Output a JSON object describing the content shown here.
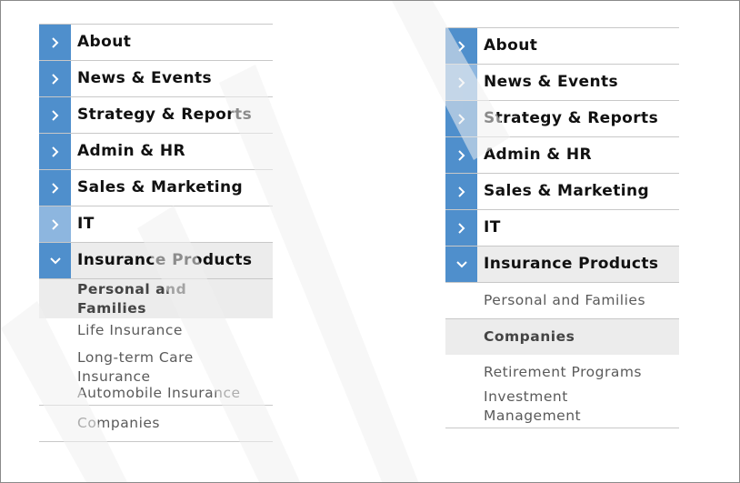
{
  "left_menu": {
    "items": [
      {
        "label": "About"
      },
      {
        "label": "News & Events"
      },
      {
        "label": "Strategy & Reports"
      },
      {
        "label": "Admin & HR"
      },
      {
        "label": "Sales & Marketing"
      },
      {
        "label": "IT"
      },
      {
        "label": "Insurance Products"
      }
    ],
    "subitems": [
      {
        "label": "Personal and Families"
      },
      {
        "label": "Life Insurance"
      },
      {
        "label": "Long-term Care Insurance"
      },
      {
        "label": "Automobile Insurance"
      },
      {
        "label": "Companies"
      }
    ]
  },
  "right_menu": {
    "items": [
      {
        "label": "About"
      },
      {
        "label": "News & Events"
      },
      {
        "label": "Strategy & Reports"
      },
      {
        "label": "Admin & HR"
      },
      {
        "label": "Sales & Marketing"
      },
      {
        "label": "IT"
      },
      {
        "label": "Insurance Products"
      }
    ],
    "subitems": [
      {
        "label": "Personal and Families"
      },
      {
        "label": "Companies"
      },
      {
        "label": "Retirement Programs"
      },
      {
        "label": "Investment Management"
      }
    ]
  },
  "colors": {
    "accent_tab": "#4f8fcc",
    "hover_tab": "#8db6df",
    "selected_bg": "#ececec",
    "divider": "#c8c8c8"
  },
  "icons": {
    "collapsed": "chevron-right-icon",
    "expanded": "chevron-down-icon"
  }
}
